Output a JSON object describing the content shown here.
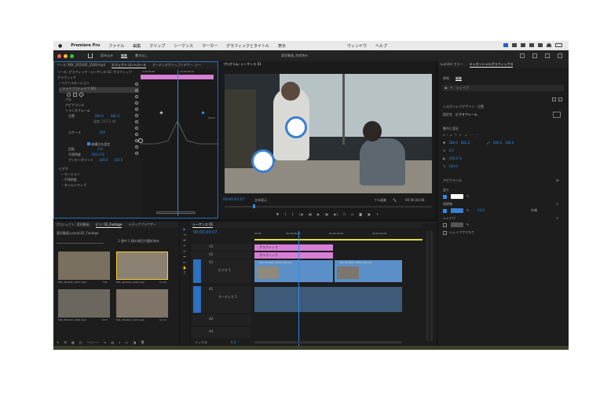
{
  "menubar": {
    "app": "Premiere Pro",
    "items": [
      "ファイル",
      "編集",
      "クリップ",
      "シーケンス",
      "マーカー",
      "グラフィックとタイトル",
      "表示",
      "ウィンドウ",
      "ヘルプ"
    ]
  },
  "header": {
    "tabs": [
      "読み込み",
      "編集",
      "書き出し"
    ],
    "active_tab": "編集",
    "project_title": "変形動画_完成済み"
  },
  "effect_controls": {
    "tabs": [
      "ソース: MIX_3D1002_1268.mp4",
      "エフェクトコントロール",
      "オーディオクリップミキサー: シー"
    ],
    "active_tab": "エフェクトコントロール",
    "clip_label": "ソース: グラフィック・シーケンス 01: グラフィック",
    "section_label": "グラフィック",
    "rows": [
      "ベクトルモーション",
      "シェイプ (シェイプ 01)",
      "パス",
      "アピアランス",
      "トランスフォーム",
      "位置",
      "スケール",
      "回転",
      "不透明度",
      "アンカーポイント",
      "ビデオ",
      "モーション",
      "不透明度",
      "タイムリマップ"
    ],
    "position_values": [
      "286.0",
      "681.2"
    ],
    "scale_value": "100",
    "rotation_value": "0.0",
    "opacity_value": "100.0 %",
    "anchor_values": [
      "100.0",
      "100.0"
    ],
    "mini_timecodes": [
      "0:00:00:00",
      "00:00:05:12"
    ],
    "speed_label": "速度: 157.2 /秒",
    "uniform_label": "縦横比を固定",
    "graph_value": "534.3"
  },
  "program": {
    "title": "プログラム: シーケンス 01",
    "timecode": "00:00:03:07",
    "fit_label": "全体表示",
    "quality_label": "フル画質",
    "duration": "00:00:20:08"
  },
  "project": {
    "tabs": [
      "プロジェクト: 変形動画",
      "ビン: 02_Footage",
      "メディアブラウザー"
    ],
    "active_tab": "ビン: 02_Footage",
    "path": "変形動画.prproj\\02_Footage",
    "search_hint": "1 個中 1 個の項目が選択済み",
    "clips": [
      {
        "name": "MIX_3D1002_1261.mp4",
        "duration": "7:01"
      },
      {
        "name": "MIX_3D1002_1268.mp4",
        "duration": "17:22"
      },
      {
        "name": "MIX_3D1002_1266.mp4",
        "duration": "8:07"
      },
      {
        "name": "MIX_3D1002_1263.mp4",
        "duration": "11:12"
      }
    ]
  },
  "timeline": {
    "tab": "シーケンス 01",
    "timecode": "00:00:03:07",
    "ruler": [
      "00:00",
      "00:00:05:00",
      "00:00:10:00",
      "00:00:15:00"
    ],
    "tracks_video": [
      "V3",
      "V2",
      "V1"
    ],
    "tracks_audio": [
      "A1",
      "A2",
      "A3"
    ],
    "video_track_label": "ビデオ 1",
    "audio_track_label": "オーディオ 1",
    "graphic_clips": [
      "グラフィック",
      "グラフィック"
    ],
    "video_clips": [
      "MIX_3D1002_1268.mp4 [V]",
      "MIX_3D1002_1266.mp4 [V]"
    ],
    "mix_label": "ミックス",
    "mix_value": "0.0"
  },
  "essential_graphics": {
    "tabs": [
      "Lumetri カラー",
      "エッセンシャルグラフィックス"
    ],
    "active_tab": "エッセンシャルグラフィックス",
    "subtabs": [
      "参照",
      "編集"
    ],
    "active_subtab": "編集",
    "layer_name": "シェイプ",
    "responsive_label": "レスポンシブデザイン - 位置",
    "pin_label": "固定先",
    "pin_value": "ビデオフレーム",
    "align_label": "整列と変形",
    "transform_values": [
      "286.0",
      "681.2",
      "100.0",
      "100.0"
    ],
    "rotation_value": "0.0",
    "opacity_value": "100.0 %",
    "scale_value": "100.0",
    "appearance_label": "アピアランス",
    "fill_label": "塗り",
    "stroke_label": "境界線",
    "stroke_value": "10.0",
    "stroke_mode": "外側",
    "shadow_label": "シャドウ",
    "mask_label": "シェイプでマスク"
  },
  "colors": {
    "accent_blue": "#2d8ceb",
    "pink_clip": "#d67fd6",
    "video_clip": "#5b8fc7",
    "fill_swatch": "#ffffff",
    "stroke_swatch": "#3a7fcf",
    "panel_bg": "#1d1d1d"
  }
}
